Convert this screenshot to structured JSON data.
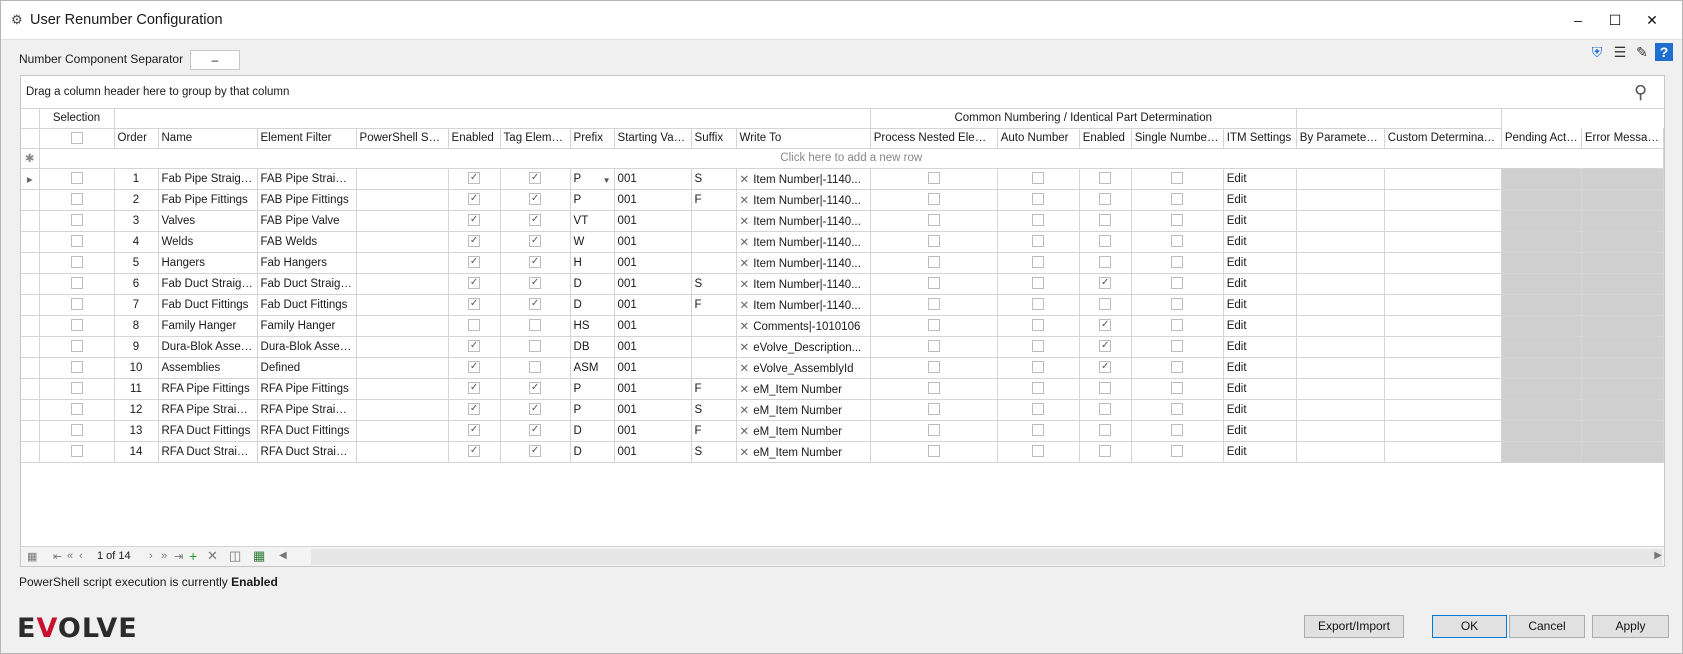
{
  "window": {
    "title": "User Renumber Configuration"
  },
  "separator": {
    "label": "Number Component Separator",
    "value": "–"
  },
  "grid": {
    "group_panel_text": "Drag a column header here to group by that column",
    "band_selection": "Selection",
    "band_common": "Common Numbering / Identical Part Determination",
    "columns": {
      "order": "Order",
      "name": "Name",
      "element_filter": "Element Filter",
      "powershell_script": "PowerShell Script",
      "enabled": "Enabled",
      "tag_element": "Tag Element",
      "prefix": "Prefix",
      "starting_value": "Starting Value",
      "suffix": "Suffix",
      "write_to": "Write To",
      "process_nested": "Process Nested Eleme...",
      "auto_number": "Auto Number",
      "cn_enabled": "Enabled",
      "single_numbering": "Single Numbering",
      "itm_settings": "ITM Settings",
      "by_parameter": "By Parameter(s)",
      "custom_determination": "Custom Determination",
      "pending_action": "Pending Action",
      "error_message": "Error Message"
    },
    "new_row_text": "Click here to add a new row",
    "rows": [
      {
        "order": "1",
        "name": "Fab Pipe Straights",
        "filter": "FAB Pipe Straights",
        "ps": "",
        "enabled": true,
        "tag": true,
        "prefix": "P",
        "start": "001",
        "suffix": "S",
        "write_to": "Item Number|-1140...",
        "nested": false,
        "auto": false,
        "cn_enabled": false,
        "single": false,
        "itm": "Edit"
      },
      {
        "order": "2",
        "name": "Fab Pipe Fittings",
        "filter": "FAB Pipe Fittings",
        "ps": "",
        "enabled": true,
        "tag": true,
        "prefix": "P",
        "start": "001",
        "suffix": "F",
        "write_to": "Item Number|-1140...",
        "nested": false,
        "auto": false,
        "cn_enabled": false,
        "single": false,
        "itm": "Edit"
      },
      {
        "order": "3",
        "name": "Valves",
        "filter": "FAB Pipe Valve",
        "ps": "",
        "enabled": true,
        "tag": true,
        "prefix": "VT",
        "start": "001",
        "suffix": "",
        "write_to": "Item Number|-1140...",
        "nested": false,
        "auto": false,
        "cn_enabled": false,
        "single": false,
        "itm": "Edit"
      },
      {
        "order": "4",
        "name": "Welds",
        "filter": "FAB Welds",
        "ps": "",
        "enabled": true,
        "tag": true,
        "prefix": "W",
        "start": "001",
        "suffix": "",
        "write_to": "Item Number|-1140...",
        "nested": false,
        "auto": false,
        "cn_enabled": false,
        "single": false,
        "itm": "Edit"
      },
      {
        "order": "5",
        "name": "Hangers",
        "filter": "Fab Hangers",
        "ps": "",
        "enabled": true,
        "tag": true,
        "prefix": "H",
        "start": "001",
        "suffix": "",
        "write_to": "Item Number|-1140...",
        "nested": false,
        "auto": false,
        "cn_enabled": false,
        "single": false,
        "itm": "Edit"
      },
      {
        "order": "6",
        "name": "Fab Duct Straights",
        "filter": "Fab Duct Straights",
        "ps": "",
        "enabled": true,
        "tag": true,
        "prefix": "D",
        "start": "001",
        "suffix": "S",
        "write_to": "Item Number|-1140...",
        "nested": false,
        "auto": false,
        "cn_enabled": true,
        "single": false,
        "itm": "Edit"
      },
      {
        "order": "7",
        "name": "Fab Duct Fittings",
        "filter": "Fab Duct Fittings",
        "ps": "",
        "enabled": true,
        "tag": true,
        "prefix": "D",
        "start": "001",
        "suffix": "F",
        "write_to": "Item Number|-1140...",
        "nested": false,
        "auto": false,
        "cn_enabled": false,
        "single": false,
        "itm": "Edit"
      },
      {
        "order": "8",
        "name": "Family Hanger",
        "filter": "Family Hanger",
        "ps": "",
        "enabled": false,
        "tag": false,
        "prefix": "HS",
        "start": "001",
        "suffix": "",
        "write_to": "Comments|-1010106",
        "nested": false,
        "auto": false,
        "cn_enabled": true,
        "single": false,
        "itm": "Edit"
      },
      {
        "order": "9",
        "name": "Dura-Blok Assem...",
        "filter": "Dura-Blok Assem...",
        "ps": "",
        "enabled": true,
        "tag": false,
        "prefix": "DB",
        "start": "001",
        "suffix": "",
        "write_to": "eVolve_Description...",
        "nested": false,
        "auto": false,
        "cn_enabled": true,
        "single": false,
        "itm": "Edit"
      },
      {
        "order": "10",
        "name": "Assemblies",
        "filter": "Defined",
        "ps": "",
        "enabled": true,
        "tag": false,
        "prefix": "ASM",
        "start": "001",
        "suffix": "",
        "write_to": "eVolve_AssemblyId",
        "nested": false,
        "auto": false,
        "cn_enabled": true,
        "single": false,
        "itm": "Edit"
      },
      {
        "order": "11",
        "name": "RFA Pipe Fittings",
        "filter": "RFA Pipe Fittings",
        "ps": "",
        "enabled": true,
        "tag": true,
        "prefix": "P",
        "start": "001",
        "suffix": "F",
        "write_to": "eM_Item Number",
        "nested": false,
        "auto": false,
        "cn_enabled": false,
        "single": false,
        "itm": "Edit"
      },
      {
        "order": "12",
        "name": "RFA Pipe Straights",
        "filter": "RFA Pipe Straights",
        "ps": "",
        "enabled": true,
        "tag": true,
        "prefix": "P",
        "start": "001",
        "suffix": "S",
        "write_to": "eM_Item Number",
        "nested": false,
        "auto": false,
        "cn_enabled": false,
        "single": false,
        "itm": "Edit"
      },
      {
        "order": "13",
        "name": "RFA Duct Fittings",
        "filter": "RFA Duct Fittings",
        "ps": "",
        "enabled": true,
        "tag": true,
        "prefix": "D",
        "start": "001",
        "suffix": "F",
        "write_to": "eM_Item Number",
        "nested": false,
        "auto": false,
        "cn_enabled": false,
        "single": false,
        "itm": "Edit"
      },
      {
        "order": "14",
        "name": "RFA Duct Straights",
        "filter": "RFA Duct Straights",
        "ps": "",
        "enabled": true,
        "tag": true,
        "prefix": "D",
        "start": "001",
        "suffix": "S",
        "write_to": "eM_Item Number",
        "nested": false,
        "auto": false,
        "cn_enabled": false,
        "single": false,
        "itm": "Edit"
      }
    ],
    "pager_text": "1 of 14"
  },
  "status": {
    "prefix": "PowerShell script execution is currently",
    "state": "Enabled"
  },
  "logo": {
    "text": "EVOLVE"
  },
  "buttons": {
    "export_import": "Export/Import",
    "ok": "OK",
    "cancel": "Cancel",
    "apply": "Apply"
  },
  "colors": {
    "accent": "#0078d7",
    "logo_red": "#c8102e",
    "grey_cell": "#cfcfcf"
  }
}
